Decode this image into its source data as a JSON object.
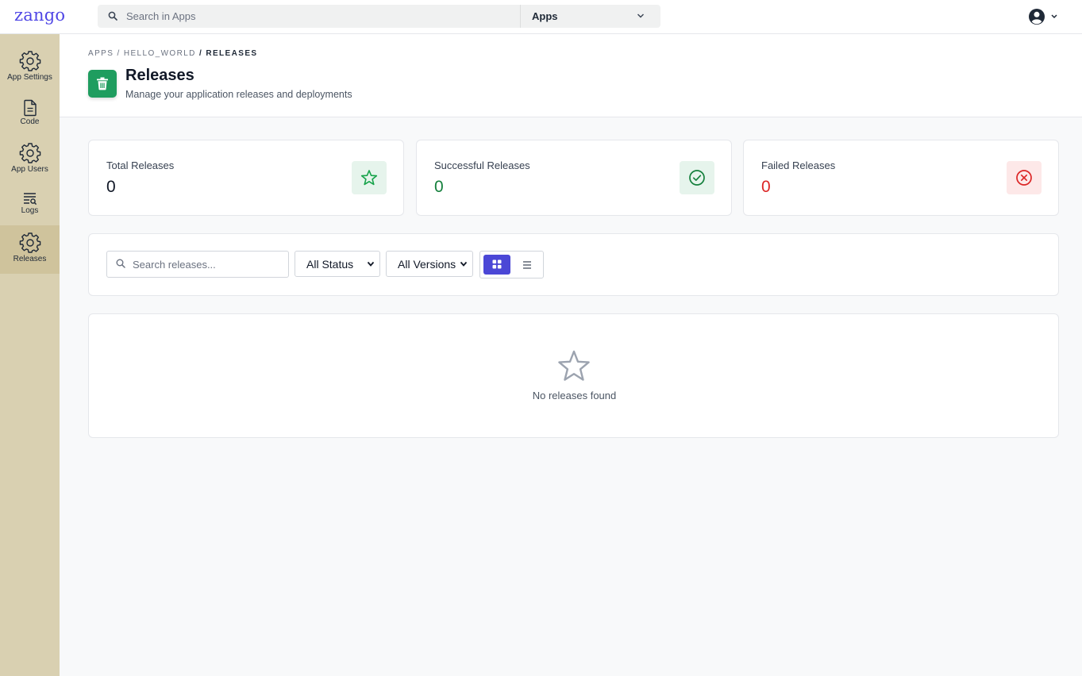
{
  "topbar": {
    "logo": "zango",
    "search_placeholder": "Search in Apps",
    "scope_label": "Apps",
    "icons": {
      "search": "search-icon",
      "scope": "chevron-down-icon",
      "user": "user-avatar-icon"
    }
  },
  "sidebar": {
    "items": [
      {
        "label": "App Settings",
        "icon": "gear-icon",
        "active": false
      },
      {
        "label": "Code",
        "icon": "file-code-icon",
        "active": false
      },
      {
        "label": "App Users",
        "icon": "gear-icon",
        "active": false
      },
      {
        "label": "Logs",
        "icon": "logs-icon",
        "active": false
      },
      {
        "label": "Releases",
        "icon": "gear-icon",
        "active": true
      }
    ],
    "active_color": "#cfc39c",
    "bg_color": "#d9d0b1"
  },
  "header": {
    "breadcrumb": {
      "part1": "APPS",
      "sep1": " / ",
      "part2": "HELLO_WORLD",
      "sep2": " / ",
      "current": "RELEASES"
    },
    "title": "Releases",
    "subtitle": "Manage your application releases and deployments",
    "icon": "trash-icon",
    "icon_color": "#1f9d5f"
  },
  "stats": [
    {
      "label": "Total Releases",
      "value": "0",
      "value_color": "#111827",
      "icon": "star-icon",
      "icon_bg": "#e6f4ec",
      "icon_color": "#16a34a"
    },
    {
      "label": "Successful Releases",
      "value": "0",
      "value_color": "#15803d",
      "icon": "check-circle-icon",
      "icon_bg": "#e6f4ec",
      "icon_color": "#15803d"
    },
    {
      "label": "Failed Releases",
      "value": "0",
      "value_color": "#dc2626",
      "icon": "x-circle-icon",
      "icon_bg": "#fde8e8",
      "icon_color": "#dc2626"
    }
  ],
  "filters": {
    "search_placeholder": "Search releases...",
    "status_select": "All Status",
    "version_select": "All Versions",
    "view_modes": [
      "grid",
      "list"
    ],
    "active_view": "grid",
    "accent": "#4b47d6"
  },
  "empty_state": {
    "text": "No releases found",
    "icon": "star-outline-icon"
  }
}
